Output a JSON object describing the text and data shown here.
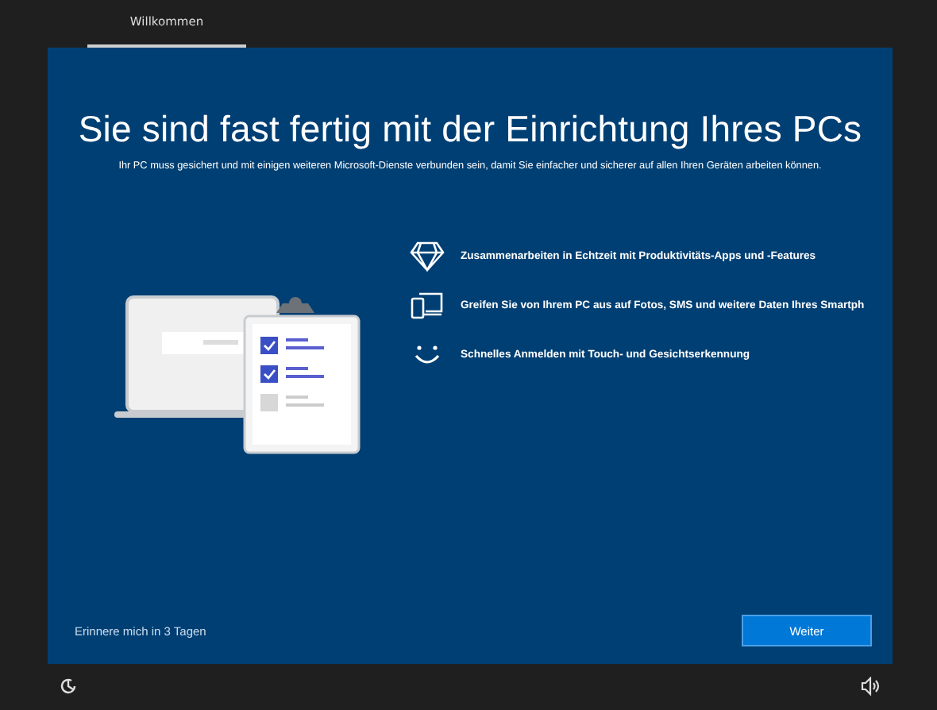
{
  "tabs": [
    {
      "label": "Willkommen",
      "selected": true
    }
  ],
  "title": "Sie sind fast fertig mit der Einrichtung Ihres PCs",
  "subtitle": "Ihr PC muss gesichert und mit einigen weiteren Microsoft-Dienste verbunden sein, damit Sie einfacher und sicherer auf allen Ihren Geräten arbeiten können.",
  "features": [
    {
      "kind": "diamond",
      "text": "Zusammenarbeiten in Echtzeit mit Produktivitäts-Apps und -Features"
    },
    {
      "kind": "devices",
      "text": "Greifen Sie von Ihrem PC aus auf Fotos, SMS und weitere Daten Ihres Smartph"
    },
    {
      "kind": "smile",
      "text": "Schnelles Anmelden mit Touch- und Gesichtserkennung"
    }
  ],
  "checklist": [
    {
      "checked": true
    },
    {
      "checked": true
    },
    {
      "checked": false
    }
  ],
  "remind_link": "Erinnere mich in 3 Tagen",
  "next_button": "Weiter"
}
